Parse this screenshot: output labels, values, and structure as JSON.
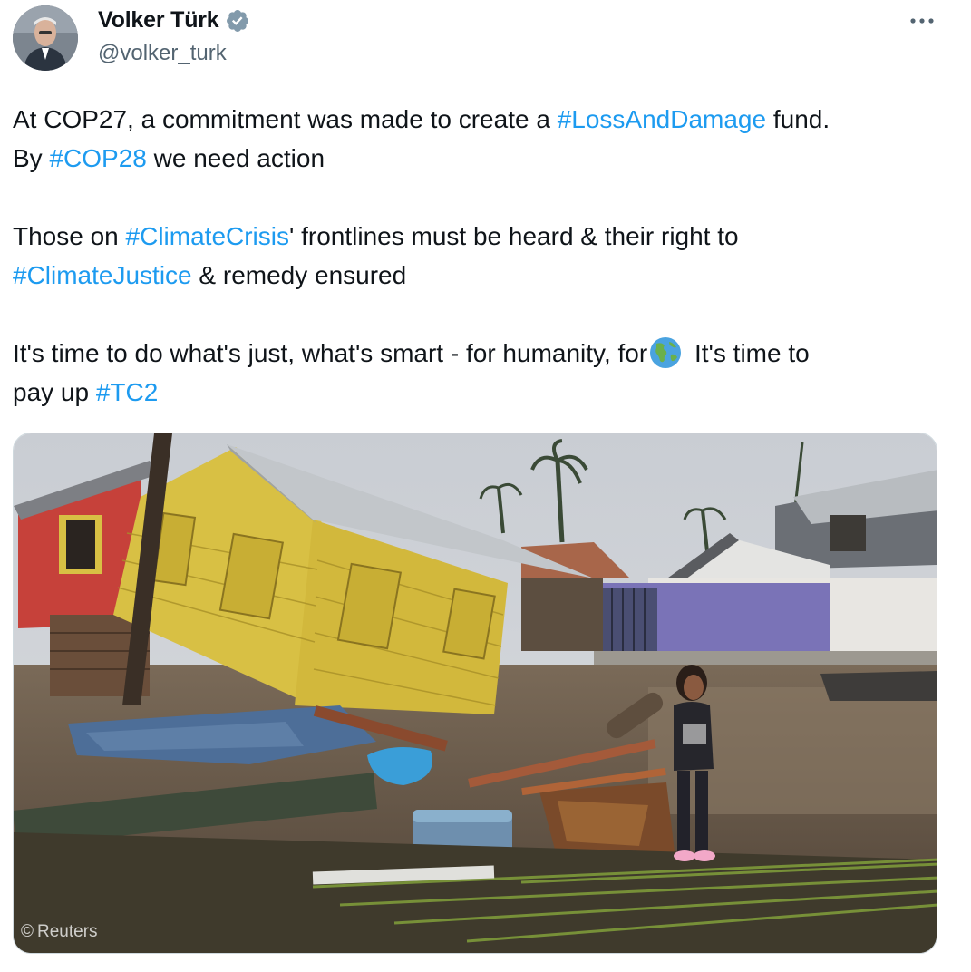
{
  "author": {
    "name": "Volker Türk",
    "handle": "@volker_turk",
    "verified_icon": "verified-badge-icon"
  },
  "menu": {
    "icon": "more-dots-icon"
  },
  "tweet": {
    "line1_pre": "At COP27, a commitment was made to create a ",
    "tag_loss": "#LossAndDamage",
    "line1_post": " fund.",
    "line2_pre": "By ",
    "tag_cop28": "#COP28",
    "line2_post": " we need action",
    "line3_pre": "Those on ",
    "tag_crisis": "#ClimateCrisis",
    "line3_post": "' frontlines must be heard & their right to",
    "tag_justice": "#ClimateJustice",
    "line4_post": " & remedy ensured",
    "line5_pre": "It's time to do what's just, what's smart - for humanity, for",
    "globe_icon": "globe-americas-icon",
    "line5_post": " It's time to",
    "line6_pre": "pay up ",
    "tag_tc2": "#TC2"
  },
  "media": {
    "credit": "Reuters",
    "credit_symbol": "©",
    "colors": {
      "sky": "#cfd4da",
      "yellow_house": "#d8c044",
      "red_house": "#c6413a",
      "purple_wall": "#7a73b7",
      "ground": "#6a5a48",
      "debris_blue": "#4d6e98"
    }
  }
}
